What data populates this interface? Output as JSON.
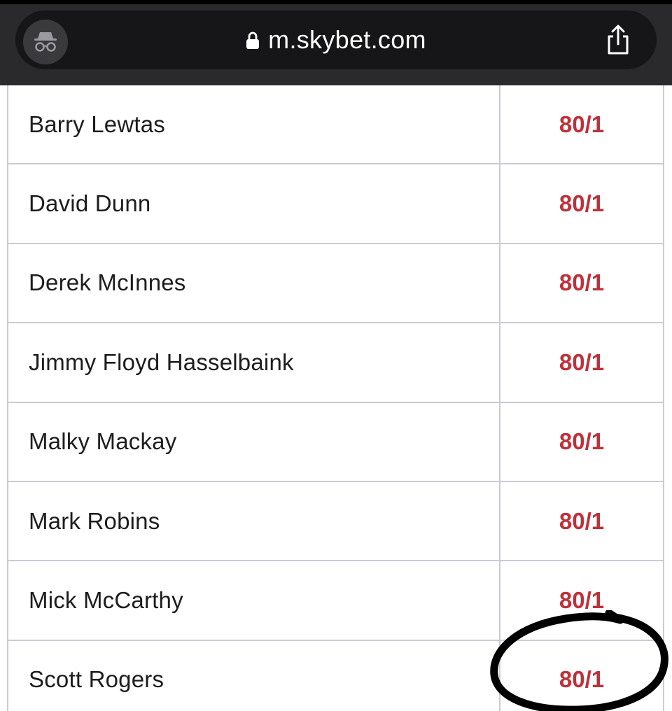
{
  "browser": {
    "url": "m.skybet.com",
    "icons": {
      "incognito": "incognito-icon",
      "lock": "lock-icon",
      "share": "share-icon"
    }
  },
  "market": {
    "rows": [
      {
        "name": "Barry Lewtas",
        "odds": "80/1"
      },
      {
        "name": "David Dunn",
        "odds": "80/1"
      },
      {
        "name": "Derek McInnes",
        "odds": "80/1"
      },
      {
        "name": "Jimmy Floyd Hasselbaink",
        "odds": "80/1"
      },
      {
        "name": "Malky Mackay",
        "odds": "80/1"
      },
      {
        "name": "Mark Robins",
        "odds": "80/1"
      },
      {
        "name": "Mick McCarthy",
        "odds": "80/1"
      },
      {
        "name": "Scott Rogers",
        "odds": "80/1"
      }
    ]
  },
  "colors": {
    "odds": "#c0303a",
    "annotation": "#000000"
  }
}
